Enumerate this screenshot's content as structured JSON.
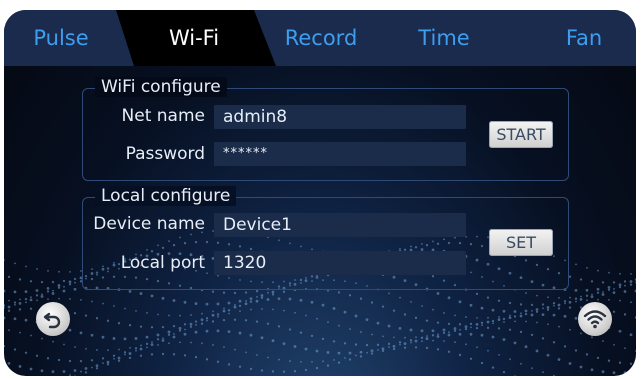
{
  "tabs": [
    {
      "label": "Pulse",
      "active": false
    },
    {
      "label": "Wi-Fi",
      "active": true
    },
    {
      "label": "Record",
      "active": false
    },
    {
      "label": "Time",
      "active": false
    },
    {
      "label": "Fan",
      "active": false
    }
  ],
  "wifi_group": {
    "title": "WiFi configure",
    "net_name_label": "Net name",
    "net_name_value": "admin8",
    "password_label": "Password",
    "password_value": "******",
    "start_button": "START"
  },
  "local_group": {
    "title": "Local configure",
    "device_name_label": "Device name",
    "device_name_value": "Device1",
    "local_port_label": "Local port",
    "local_port_value": "1320",
    "set_button": "SET"
  },
  "icons": {
    "back": "back-arrow-icon",
    "wifi": "wifi-icon"
  },
  "colors": {
    "accent_tab": "#3d9ef0",
    "active_tab_text": "#ffffff",
    "field_bg": "#1a2c4a"
  }
}
